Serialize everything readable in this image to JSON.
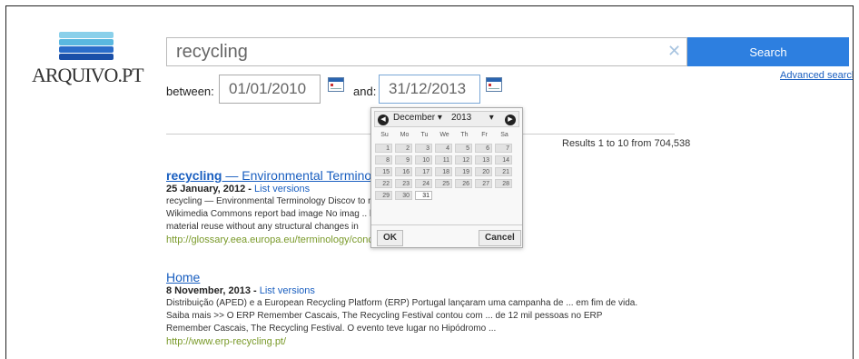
{
  "logo": {
    "text": "ARQUIVO.PT",
    "colors": [
      "#1a4fa8",
      "#2a6cc9",
      "#5ab8e0",
      "#8ad0ea"
    ]
  },
  "search": {
    "value": "recycling",
    "clear_icon": "close-icon",
    "button_label": "Search",
    "advanced_label": "Advanced search"
  },
  "dates": {
    "between_label": "between:",
    "from": "01/01/2010",
    "and_label": "and:",
    "to": "31/12/2013",
    "icon": "calendar-icon"
  },
  "results_count": "Results 1 to 10 from 704,538",
  "calendar": {
    "month": "December",
    "year": "2013",
    "dow": [
      "Su",
      "Mo",
      "Tu",
      "We",
      "Th",
      "Fr",
      "Sa"
    ],
    "weeks": [
      [
        "1",
        "2",
        "3",
        "4",
        "5",
        "6",
        "7"
      ],
      [
        "8",
        "9",
        "10",
        "11",
        "12",
        "13",
        "14"
      ],
      [
        "15",
        "16",
        "17",
        "18",
        "19",
        "20",
        "21"
      ],
      [
        "22",
        "23",
        "24",
        "25",
        "26",
        "27",
        "28"
      ],
      [
        "29",
        "30",
        "31",
        "",
        "",
        "",
        ""
      ]
    ],
    "enabled_day": "31",
    "ok_label": "OK",
    "cancel_label": "Cancel"
  },
  "results": [
    {
      "title_bold": "recycling",
      "title_rest": " — Environmental Terminolo...",
      "date": "25 January, 2012",
      "versions_label": "List versions",
      "snippet_lines": [
        "recycling — Environmental Terminology Discov                                                          to navigation ... : Credits:",
        "Wikimedia Commons report bad image No imag                                                          .. between: reuse meant as a",
        "material reuse without any structural changes in"
      ],
      "url": "http://glossary.eea.europa.eu/terminology/concept_html?term=recycling"
    },
    {
      "title_bold": "",
      "title_rest": "Home",
      "date": "8 November, 2013",
      "versions_label": "List versions",
      "snippet_lines": [
        "Distribuição (APED) e a European Recycling Platform (ERP) Portugal lançaram uma campanha de ... em fim de vida.",
        "Saiba mais >>          O ERP Remember Cascais, The Recycling Festival contou com ... de 12 mil pessoas no ERP",
        "Remember Cascais, The Recycling Festival. O evento teve lugar no Hipódromo ..."
      ],
      "url": "http://www.erp-recycling.pt/"
    }
  ]
}
